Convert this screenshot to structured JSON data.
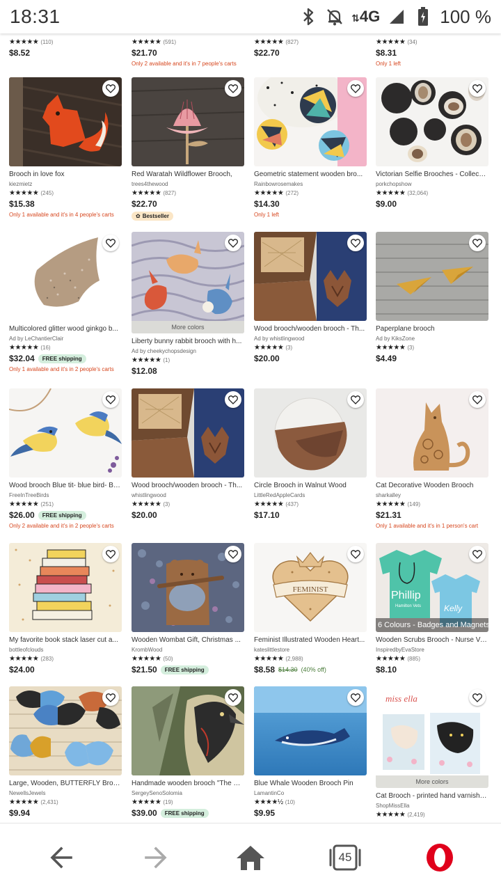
{
  "status": {
    "time": "18:31",
    "network": "4G",
    "battery": "100 %"
  },
  "top_row": [
    {
      "rating_count": "(110)",
      "price": "$8.52",
      "note": ""
    },
    {
      "rating_count": "(591)",
      "price": "$21.70",
      "note": "Only 2 available and it's in 7 people's carts"
    },
    {
      "rating_count": "(827)",
      "price": "$22.70",
      "note": ""
    },
    {
      "rating_count": "(34)",
      "price": "$8.31",
      "note": "Only 1 left"
    }
  ],
  "rows": [
    [
      {
        "title": "Brooch in love fox",
        "shop": "kiezmietz",
        "stars": "★★★★★",
        "rating_count": "(245)",
        "price": "$15.38",
        "free_shipping": "",
        "note": "Only 1 available and it's in 4 people's carts",
        "badge": ""
      },
      {
        "title": "Red Waratah Wildflower Brooch,",
        "shop": "trees4thewood",
        "stars": "★★★★★",
        "rating_count": "(827)",
        "price": "$22.70",
        "free_shipping": "",
        "note": "",
        "badge": "Bestseller"
      },
      {
        "title": "Geometric statement wooden bro...",
        "shop": "Rainbowrosemakes",
        "stars": "★★★★★",
        "rating_count": "(272)",
        "price": "$14.30",
        "free_shipping": "",
        "note": "Only 1 left",
        "badge": ""
      },
      {
        "title": "Victorian Selfie Brooches - Collecti...",
        "shop": "porkchopshow",
        "stars": "★★★★★",
        "rating_count": "(32,064)",
        "price": "$9.00",
        "free_shipping": "",
        "note": "",
        "badge": ""
      }
    ],
    [
      {
        "title": "Multicolored glitter wood ginkgo b...",
        "shop": "Ad by LeChantierClair",
        "stars": "★★★★★",
        "rating_count": "(16)",
        "price": "$32.04",
        "free_shipping": "FREE shipping",
        "note": "Only 1 available and it's in 2 people's carts",
        "badge": ""
      },
      {
        "title": "Liberty bunny rabbit brooch with h...",
        "shop": "Ad by cheekychopsdesign",
        "stars": "★★★★★",
        "rating_count": "(1)",
        "price": "$12.08",
        "free_shipping": "",
        "note": "",
        "badge": "",
        "more_colors": "More colors"
      },
      {
        "title": "Wood brooch/wooden brooch - Th...",
        "shop": "Ad by whistlingwood",
        "stars": "★★★★★",
        "rating_count": "(3)",
        "price": "$20.00",
        "free_shipping": "",
        "note": "",
        "badge": ""
      },
      {
        "title": "Paperplane brooch",
        "shop": "Ad by KiksZone",
        "stars": "★★★★★",
        "rating_count": "(3)",
        "price": "$4.49",
        "free_shipping": "",
        "note": "",
        "badge": ""
      }
    ],
    [
      {
        "title": "Wood brooch Blue tit- blue bird- Bir...",
        "shop": "FreeInTreeBirds",
        "stars": "★★★★★",
        "rating_count": "(251)",
        "price": "$26.00",
        "free_shipping": "FREE shipping",
        "note": "Only 2 available and it's in 2 people's carts",
        "badge": ""
      },
      {
        "title": "Wood brooch/wooden brooch - Th...",
        "shop": "whistlingwood",
        "stars": "★★★★★",
        "rating_count": "(3)",
        "price": "$20.00",
        "free_shipping": "",
        "note": "",
        "badge": ""
      },
      {
        "title": "Circle Brooch in Walnut Wood",
        "shop": "LittleRedAppleCards",
        "stars": "★★★★★",
        "rating_count": "(437)",
        "price": "$17.10",
        "free_shipping": "",
        "note": "",
        "badge": ""
      },
      {
        "title": "Cat Decorative Wooden Brooch",
        "shop": "sharkalley",
        "stars": "★★★★★",
        "rating_count": "(149)",
        "price": "$21.31",
        "free_shipping": "",
        "note": "Only 1 available and it's in 1 person's cart",
        "badge": ""
      }
    ],
    [
      {
        "title": "My favorite book stack laser cut a...",
        "shop": "bottleofclouds",
        "stars": "★★★★★",
        "rating_count": "(283)",
        "price": "$24.00",
        "free_shipping": "",
        "note": "",
        "badge": ""
      },
      {
        "title": "Wooden Wombat Gift, Christmas ...",
        "shop": "KrombWood",
        "stars": "★★★★★",
        "rating_count": "(50)",
        "price": "$21.50",
        "free_shipping": "FREE shipping",
        "note": "",
        "badge": ""
      },
      {
        "title": "Feminist Illustrated Wooden Heart...",
        "shop": "kateslittlestore",
        "stars": "★★★★★",
        "rating_count": "(2,988)",
        "price": "$8.58",
        "old_price": "$14.30",
        "discount": "(40% off)",
        "free_shipping": "",
        "note": "",
        "badge": ""
      },
      {
        "title": "Wooden Scrubs Brooch - Nurse Ve...",
        "shop": "InspiredbyEvaStore",
        "stars": "★★★★★",
        "rating_count": "(885)",
        "price": "$8.10",
        "free_shipping": "",
        "note": "",
        "badge": "",
        "image_caption": "6 Colours - Badges and Magnets",
        "image_text1": "Phillip",
        "image_text2": "Hamilton Vets",
        "image_text3": "Kelly"
      }
    ],
    [
      {
        "title": "Large, Wooden, BUTTERFLY Brooc...",
        "shop": "NewellsJewels",
        "stars": "★★★★★",
        "rating_count": "(2,431)",
        "price": "$9.94",
        "free_shipping": "",
        "note": "",
        "badge": ""
      },
      {
        "title": "Handmade wooden brooch \"The R...",
        "shop": "SergeySenoSolomia",
        "stars": "★★★★★",
        "rating_count": "(19)",
        "price": "$39.00",
        "free_shipping": "FREE shipping",
        "note": "",
        "badge": ""
      },
      {
        "title": "Blue Whale Wooden Brooch Pin",
        "shop": "LamantinCo",
        "stars": "★★★★½",
        "rating_count": "(10)",
        "price": "$9.95",
        "free_shipping": "",
        "note": "",
        "badge": ""
      },
      {
        "title": "Cat Brooch - printed hand varnishe...",
        "shop": "ShopMissElla",
        "stars": "★★★★★",
        "rating_count": "(2,419)",
        "price": "",
        "free_shipping": "",
        "note": "",
        "badge": "",
        "more_colors": "More colors",
        "image_text1": "miss ella"
      }
    ]
  ],
  "bottom_nav": {
    "tabs_count": "45"
  },
  "colors": {
    "note": "#d6461e",
    "free_shipping_bg": "#d4eedd",
    "bestseller_bg": "#fbe6c6",
    "opera_red": "#e0001b"
  }
}
